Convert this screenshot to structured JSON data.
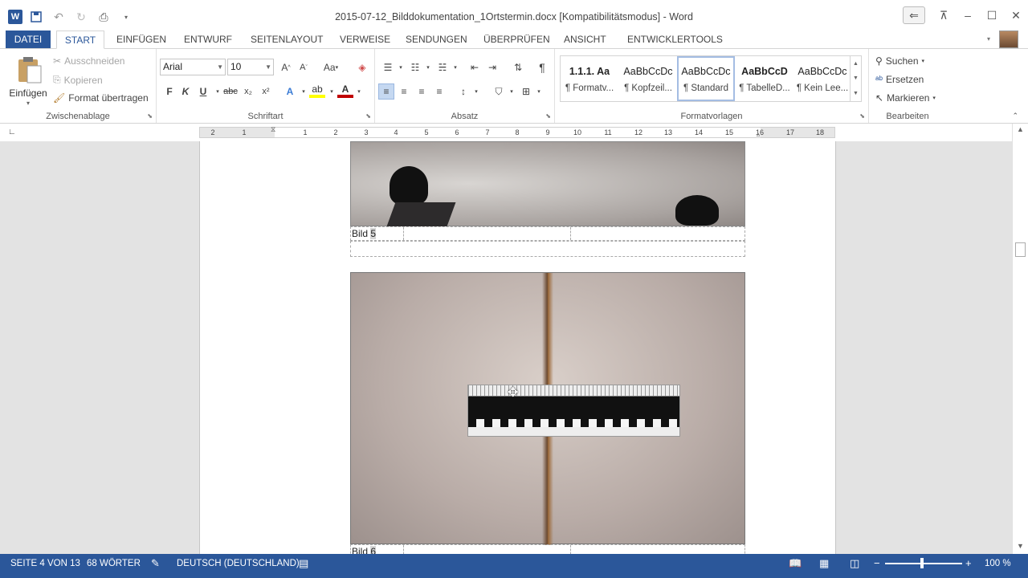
{
  "window": {
    "title": "2015-07-12_Bilddokumentation_1Ortstermin.docx [Kompatibilitätsmodus] - Word"
  },
  "tabs": [
    {
      "label": "DATEI"
    },
    {
      "label": "START"
    },
    {
      "label": "EINFÜGEN"
    },
    {
      "label": "ENTWURF"
    },
    {
      "label": "SEITENLAYOUT"
    },
    {
      "label": "VERWEISE"
    },
    {
      "label": "SENDUNGEN"
    },
    {
      "label": "ÜBERPRÜFEN"
    },
    {
      "label": "ANSICHT"
    },
    {
      "label": "ENTWICKLERTOOLS"
    }
  ],
  "clipboard": {
    "paste": "Einfügen",
    "cut": "Ausschneiden",
    "copy": "Kopieren",
    "format_painter": "Format übertragen",
    "label": "Zwischenablage"
  },
  "font": {
    "name": "Arial",
    "size": "10",
    "label": "Schriftart",
    "bold": "F",
    "italic": "K",
    "underline": "U",
    "strike": "abc",
    "change_case": "Aa"
  },
  "paragraph": {
    "label": "Absatz"
  },
  "styles": {
    "label": "Formatvorlagen",
    "items": [
      {
        "preview": "1.1.1. Aa",
        "name": "¶ Formatv..."
      },
      {
        "preview": "AaBbCcDc",
        "name": "¶ Kopfzeil..."
      },
      {
        "preview": "AaBbCcDc",
        "name": "¶ Standard"
      },
      {
        "preview": "AaBbCcD",
        "name": "¶ TabelleD..."
      },
      {
        "preview": "AaBbCcDc",
        "name": "¶ Kein Lee..."
      }
    ]
  },
  "editing": {
    "search": "Suchen",
    "replace": "Ersetzen",
    "select": "Markieren",
    "label": "Bearbeiten"
  },
  "ruler": {
    "numbers": [
      "2",
      "1",
      "1",
      "2",
      "3",
      "4",
      "5",
      "6",
      "7",
      "8",
      "9",
      "10",
      "11",
      "12",
      "13",
      "14",
      "15",
      "16",
      "17",
      "18"
    ]
  },
  "document": {
    "caption1_prefix": "Bild ",
    "caption1_num": "5",
    "caption2_prefix": "Bild ",
    "caption2_num": "6"
  },
  "status": {
    "page": "SEITE 4 VON 13",
    "words": "68 WÖRTER",
    "language": "DEUTSCH (DEUTSCHLAND)",
    "zoom": "100 %",
    "zoom_level_percent": 100
  },
  "icons": {
    "word": "word-logo-icon",
    "save": "save-icon",
    "undo": "undo-icon",
    "redo": "redo-icon"
  }
}
